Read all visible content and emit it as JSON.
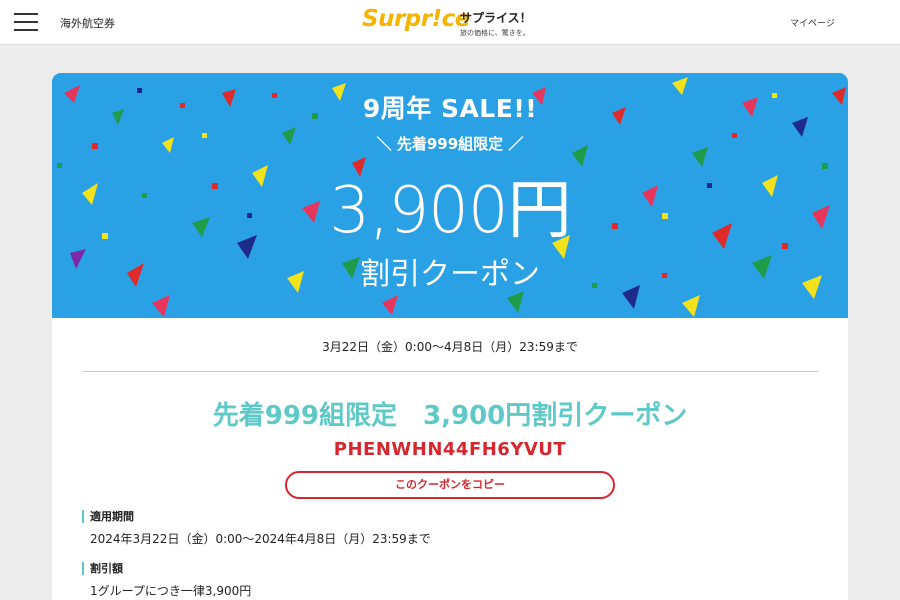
{
  "header": {
    "nav_link": "海外航空券",
    "logo_text": "Surpr!ce",
    "brand_name": "サプライス！",
    "brand_tagline": "旅の価格に、驚きを。",
    "mypage": "マイページ"
  },
  "banner": {
    "sale": "9周年 SALE!!",
    "limit": "＼ 先着999組限定 ／",
    "amount": "3,900円",
    "coupon": "割引クーポン"
  },
  "coupon": {
    "period": "3月22日（金）0:00〜4月8日（月）23:59まで",
    "title": "先着999組限定　3,900円割引クーポン",
    "code": "PHENWHN44FH6YVUT",
    "copy_label": "このクーポンをコピー"
  },
  "details": {
    "validity_label": "適用期間",
    "validity_value": "2024年3月22日（金）0:00〜2024年4月8日（月）23:59まで",
    "discount_label": "割引額",
    "discount_value": "1グループにつき一律3,900円"
  },
  "colors": {
    "brand_yellow": "#f5b400",
    "banner_blue": "#2aa1e4",
    "title_teal": "#5fc9c8",
    "code_red": "#d7262d"
  }
}
